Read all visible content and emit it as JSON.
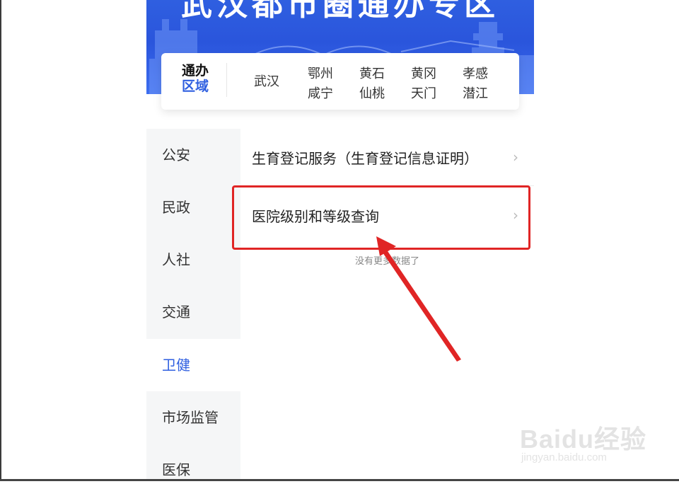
{
  "banner": {
    "title": "武汉都市圈通办专区"
  },
  "region": {
    "label_line1": "通办",
    "label_line2": "区域",
    "items": [
      {
        "label": "武汉"
      },
      {
        "label": "鄂州"
      },
      {
        "label": "咸宁"
      },
      {
        "label": "黄石"
      },
      {
        "label": "仙桃"
      },
      {
        "label": "黄冈"
      },
      {
        "label": "天门"
      },
      {
        "label": "孝感"
      },
      {
        "label": "潜江"
      }
    ]
  },
  "sidebar": {
    "selected": "卫健",
    "items": [
      {
        "label": "公安"
      },
      {
        "label": "民政"
      },
      {
        "label": "人社"
      },
      {
        "label": "交通"
      },
      {
        "label": "卫健"
      },
      {
        "label": "市场监管"
      },
      {
        "label": "医保"
      }
    ]
  },
  "services": [
    {
      "label": "生育登记服务（生育登记信息证明）"
    },
    {
      "label": "医院级别和等级查询"
    }
  ],
  "list_end_text": "没有更多数据了",
  "annotation": {
    "color": "#e02525"
  },
  "watermark": {
    "main": "Baidu经验",
    "sub": "jingyan.baidu.com"
  },
  "colors": {
    "accent": "#2f5fe0",
    "banner": "#2a55dc"
  }
}
